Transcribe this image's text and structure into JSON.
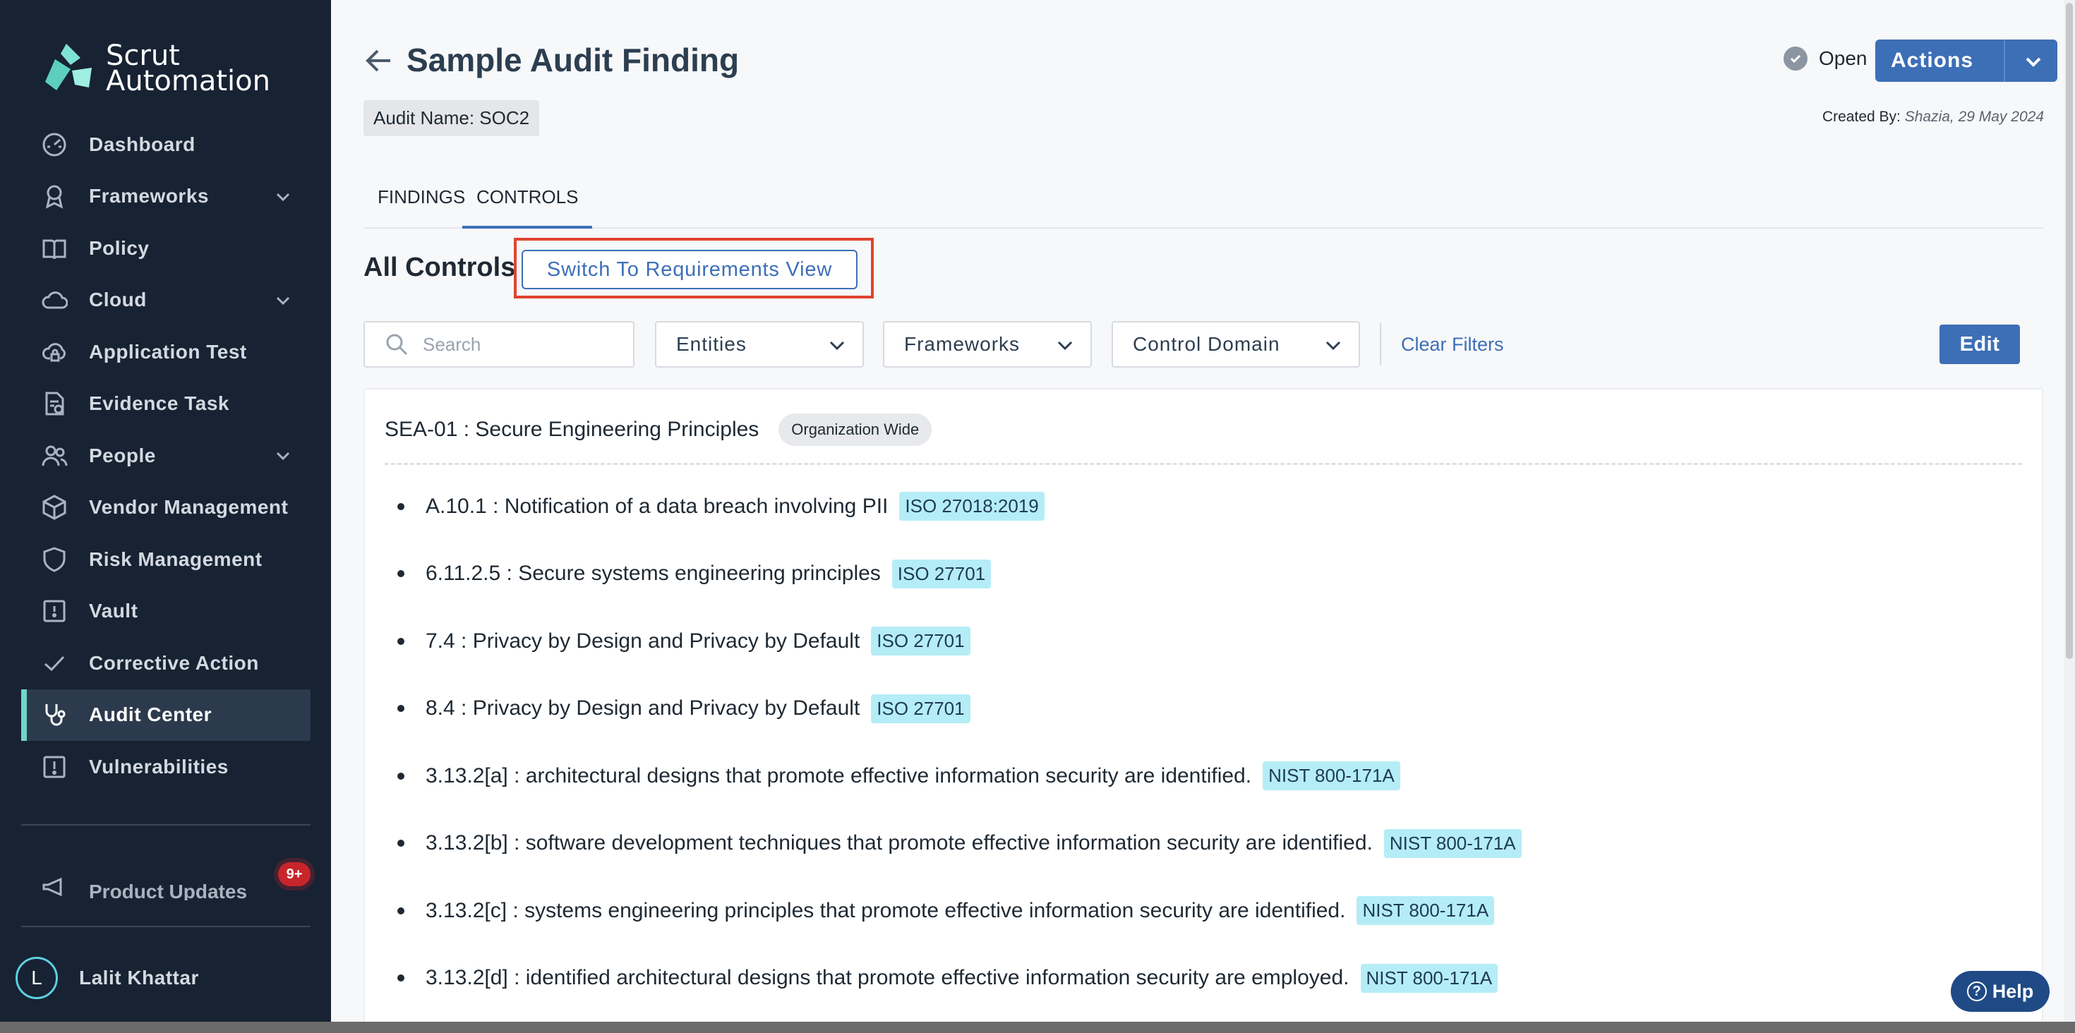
{
  "brand": {
    "line1": "Scrut",
    "line2": "Automation"
  },
  "sidebar": {
    "items": [
      {
        "label": "Dashboard",
        "icon": "dashboard-icon",
        "has_chevron": false
      },
      {
        "label": "Frameworks",
        "icon": "award-icon",
        "has_chevron": true
      },
      {
        "label": "Policy",
        "icon": "book-icon",
        "has_chevron": false
      },
      {
        "label": "Cloud",
        "icon": "cloud-icon",
        "has_chevron": true
      },
      {
        "label": "Application Test",
        "icon": "cloud-lock-icon",
        "has_chevron": false
      },
      {
        "label": "Evidence Task",
        "icon": "file-check-icon",
        "has_chevron": false
      },
      {
        "label": "People",
        "icon": "people-icon",
        "has_chevron": true
      },
      {
        "label": "Vendor Management",
        "icon": "cube-icon",
        "has_chevron": false
      },
      {
        "label": "Risk Management",
        "icon": "shield-icon",
        "has_chevron": false
      },
      {
        "label": "Vault",
        "icon": "vault-icon",
        "has_chevron": false
      },
      {
        "label": "Corrective Action",
        "icon": "check-icon",
        "has_chevron": false
      },
      {
        "label": "Audit Center",
        "icon": "stethoscope-icon",
        "has_chevron": false,
        "active": true
      },
      {
        "label": "Vulnerabilities",
        "icon": "alert-square-icon",
        "has_chevron": false
      }
    ],
    "product_updates": "Product Updates",
    "notification_badge": "9+",
    "user": {
      "initial": "L",
      "name": "Lalit Khattar"
    }
  },
  "header": {
    "title": "Sample Audit Finding",
    "audit_name": "Audit Name: SOC2",
    "status": "Open",
    "actions_label": "Actions",
    "created_by_label": "Created By:",
    "created_by_value": "Shazia, 29 May 2024"
  },
  "tabs": [
    {
      "label": "FINDINGS",
      "active": false
    },
    {
      "label": "CONTROLS",
      "active": true
    }
  ],
  "controls": {
    "heading": "All Controls",
    "switch_view_label": "Switch To Requirements View",
    "search_placeholder": "Search",
    "filters": [
      "Entities",
      "Frameworks",
      "Control Domain"
    ],
    "clear_filters": "Clear Filters",
    "edit_label": "Edit"
  },
  "control": {
    "title": "SEA-01 : Secure Engineering Principles",
    "scope": "Organization Wide",
    "requirements": [
      {
        "text": "A.10.1 : Notification of a data breach involving PII",
        "framework": "ISO 27018:2019"
      },
      {
        "text": "6.11.2.5 : Secure systems engineering principles",
        "framework": "ISO 27701"
      },
      {
        "text": "7.4 : Privacy by Design and Privacy by Default",
        "framework": "ISO 27701"
      },
      {
        "text": "8.4 : Privacy by Design and Privacy by Default",
        "framework": "ISO 27701"
      },
      {
        "text": "3.13.2[a] : architectural designs that promote effective information security are identified.",
        "framework": "NIST 800-171A"
      },
      {
        "text": "3.13.2[b] : software development techniques that promote effective information security are identified.",
        "framework": "NIST 800-171A"
      },
      {
        "text": "3.13.2[c] : systems engineering principles that promote effective information security are identified.",
        "framework": "NIST 800-171A"
      },
      {
        "text": "3.13.2[d] : identified architectural designs that promote effective information security are employed.",
        "framework": "NIST 800-171A"
      }
    ]
  },
  "help_label": "Help",
  "colors": {
    "sidebar_bg": "#172233",
    "accent": "#3d6fb7",
    "active_indicator": "#6fd7c8",
    "tag_bg": "#b5edf7",
    "highlight": "#e0442e"
  }
}
